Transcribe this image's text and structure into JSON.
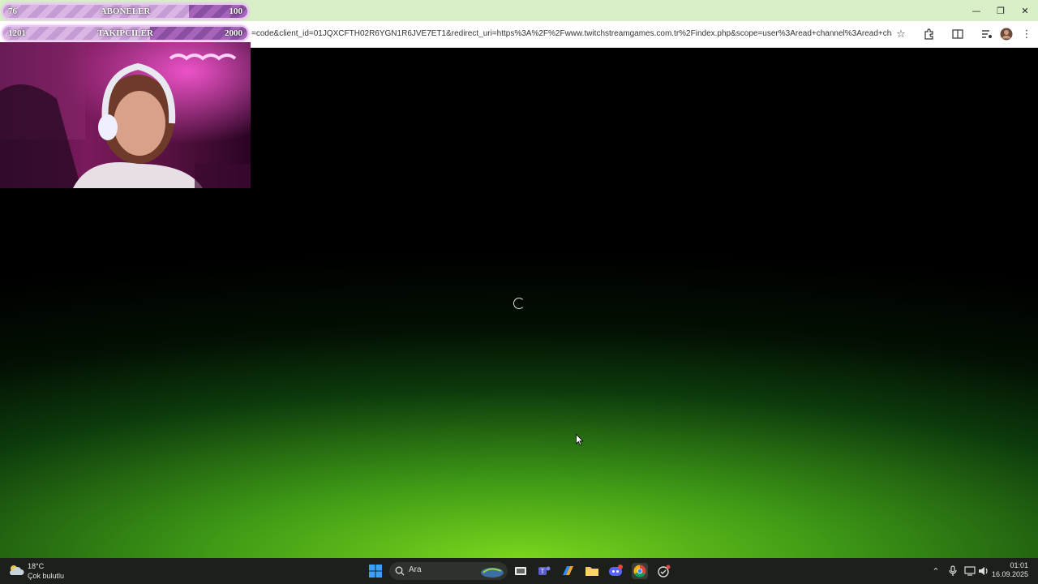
{
  "browser": {
    "url": "=code&client_id=01JQXCFTH02R6YGN1R6JVE7ET1&redirect_uri=https%3A%2F%2Fwww.twitchstreamgames.com.tr%2Findex.php&scope=user%3Aread+channel%3Aread+chat%3Awrite+eve...",
    "window_controls": {
      "minimize": "—",
      "restore": "❐",
      "close": "✕"
    },
    "toolbar_icons": [
      "star-icon",
      "extensions-icon",
      "reading-list-icon",
      "media-control-icon",
      "profile-avatar",
      "kebab-menu-icon"
    ]
  },
  "overlay": {
    "subscribers": {
      "current": "76",
      "label": "ABONELER",
      "goal": "100",
      "progress": 0.76
    },
    "followers": {
      "current": "1201",
      "label": "TAKIPCILER",
      "goal": "2000",
      "progress": 0.6
    }
  },
  "page": {
    "state": "loading"
  },
  "taskbar": {
    "weather_temp": "18°C",
    "weather_desc": "Çok bulutlu",
    "search_placeholder": "Ara",
    "clock_time": "01:01",
    "clock_date": "16.09.2025",
    "apps": [
      "windows-start",
      "search",
      "task-view",
      "teams",
      "copilot",
      "file-explorer",
      "discord",
      "chrome",
      "app-with-notification"
    ]
  },
  "colors": {
    "titlebar": "#d8efc8",
    "page_glow": "#7ad51d",
    "taskbar": "#1c1f1a"
  }
}
